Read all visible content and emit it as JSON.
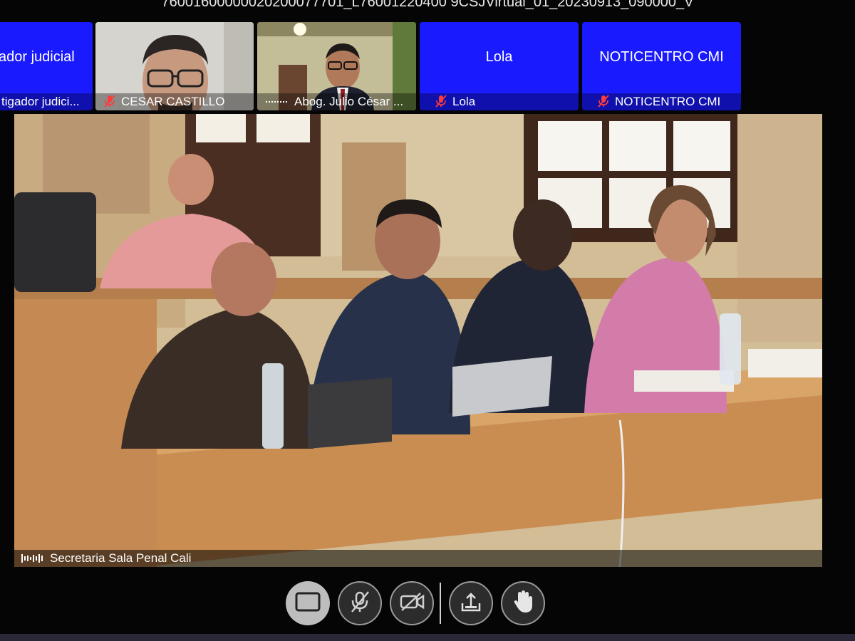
{
  "meeting": {
    "title": "76001600000020200077701_L76001220400 9CSJVirtual_01_20230913_090000_V"
  },
  "participants": [
    {
      "id": "p1",
      "tile_text": "ador judicial",
      "caption": "tigador judici...",
      "type": "avatar",
      "muted": false
    },
    {
      "id": "p2",
      "tile_text": "",
      "caption": "CESAR CASTILLO",
      "type": "camera",
      "muted": true
    },
    {
      "id": "p3",
      "tile_text": "",
      "caption": "Abog. Julio César ...",
      "type": "camera",
      "muted": false
    },
    {
      "id": "p4",
      "tile_text": "Lola",
      "caption": "Lola",
      "type": "avatar",
      "muted": true
    },
    {
      "id": "p5",
      "tile_text": "NOTICENTRO CMI",
      "caption": "NOTICENTRO CMI",
      "type": "avatar",
      "muted": true
    }
  ],
  "main_speaker": {
    "caption": "Secretaria Sala Penal Cali"
  },
  "toolbar": {
    "buttons": [
      {
        "name": "share-screen-button",
        "icon": "screen-icon"
      },
      {
        "name": "mute-mic-button",
        "icon": "mic-off-icon"
      },
      {
        "name": "camera-off-button",
        "icon": "video-off-icon"
      },
      {
        "name": "share-content-button",
        "icon": "upload-icon"
      },
      {
        "name": "raise-hand-button",
        "icon": "hand-icon"
      }
    ]
  },
  "colors": {
    "tile_blue": "#1a1aff",
    "background": "#050505",
    "mic_muted": "#ff3b3b"
  }
}
